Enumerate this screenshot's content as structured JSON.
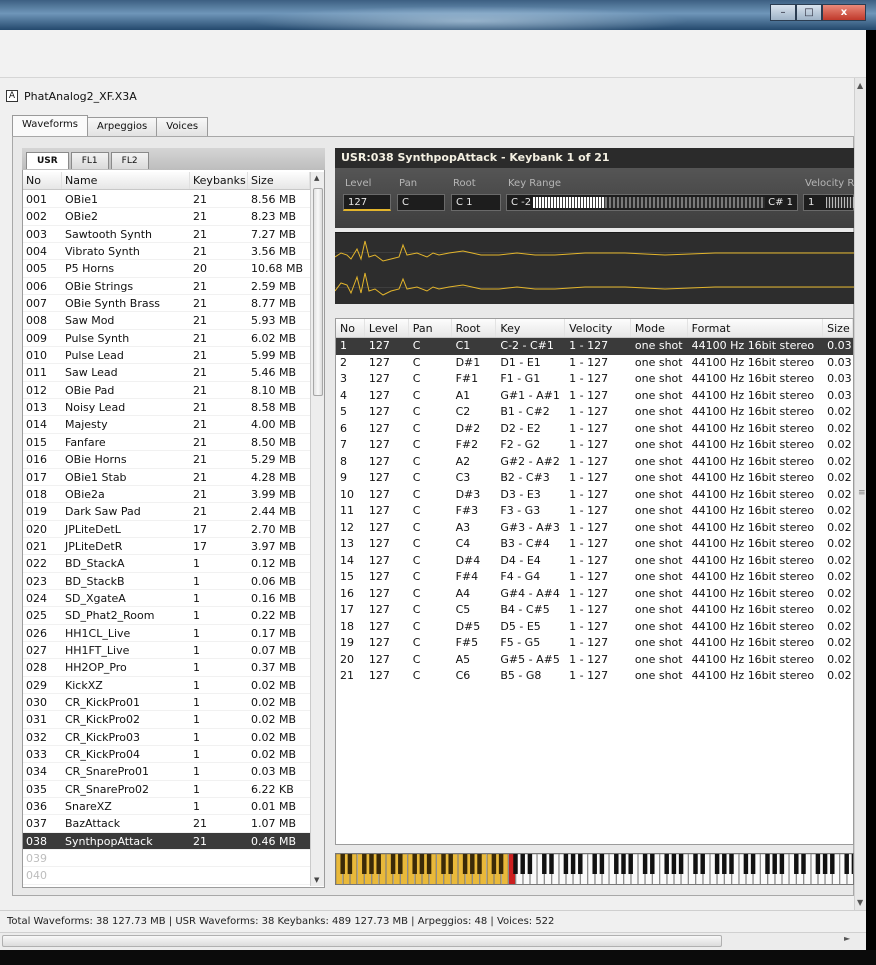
{
  "window": {
    "minimize_glyph": "–",
    "maximize_glyph": "□",
    "close_glyph": "x",
    "bg_color": "#f0f0f0",
    "title_gradient": [
      "#3c5f82",
      "#6f96b9",
      "#24496d"
    ]
  },
  "document": {
    "icon_letter": "A",
    "title": "PhatAnalog2_XF.X3A"
  },
  "tabs": [
    {
      "label": "Waveforms",
      "active": true
    },
    {
      "label": "Arpeggios",
      "active": false
    },
    {
      "label": "Voices",
      "active": false
    }
  ],
  "subtabs": [
    {
      "label": "USR",
      "active": true
    },
    {
      "label": "FL1",
      "active": false
    },
    {
      "label": "FL2",
      "active": false
    }
  ],
  "waveform_list": {
    "columns": [
      "No",
      "Name",
      "Keybanks",
      "Size"
    ],
    "rows": [
      [
        "001",
        "OBie1",
        "21",
        "8.56 MB"
      ],
      [
        "002",
        "OBie2",
        "21",
        "8.23 MB"
      ],
      [
        "003",
        "Sawtooth Synth",
        "21",
        "7.27 MB"
      ],
      [
        "004",
        "Vibrato Synth",
        "21",
        "3.56 MB"
      ],
      [
        "005",
        "P5 Horns",
        "20",
        "10.68 MB"
      ],
      [
        "006",
        "OBie Strings",
        "21",
        "2.59 MB"
      ],
      [
        "007",
        "OBie Synth Brass",
        "21",
        "8.77 MB"
      ],
      [
        "008",
        "Saw Mod",
        "21",
        "5.93 MB"
      ],
      [
        "009",
        "Pulse Synth",
        "21",
        "6.02 MB"
      ],
      [
        "010",
        "Pulse Lead",
        "21",
        "5.99 MB"
      ],
      [
        "011",
        "Saw Lead",
        "21",
        "5.46 MB"
      ],
      [
        "012",
        "OBie Pad",
        "21",
        "8.10 MB"
      ],
      [
        "013",
        "Noisy Lead",
        "21",
        "8.58 MB"
      ],
      [
        "014",
        "Majesty",
        "21",
        "4.00 MB"
      ],
      [
        "015",
        "Fanfare",
        "21",
        "8.50 MB"
      ],
      [
        "016",
        "OBie Horns",
        "21",
        "5.29 MB"
      ],
      [
        "017",
        "OBie1 Stab",
        "21",
        "4.28 MB"
      ],
      [
        "018",
        "OBie2a",
        "21",
        "3.99 MB"
      ],
      [
        "019",
        "Dark Saw Pad",
        "21",
        "2.44 MB"
      ],
      [
        "020",
        "JPLiteDetL",
        "17",
        "2.70 MB"
      ],
      [
        "021",
        "JPLiteDetR",
        "17",
        "3.97 MB"
      ],
      [
        "022",
        "BD_StackA",
        "1",
        "0.12 MB"
      ],
      [
        "023",
        "BD_StackB",
        "1",
        "0.06 MB"
      ],
      [
        "024",
        "SD_XgateA",
        "1",
        "0.16 MB"
      ],
      [
        "025",
        "SD_Phat2_Room",
        "1",
        "0.22 MB"
      ],
      [
        "026",
        "HH1CL_Live",
        "1",
        "0.17 MB"
      ],
      [
        "027",
        "HH1FT_Live",
        "1",
        "0.07 MB"
      ],
      [
        "028",
        "HH2OP_Pro",
        "1",
        "0.37 MB"
      ],
      [
        "029",
        "KickXZ",
        "1",
        "0.02 MB"
      ],
      [
        "030",
        "CR_KickPro01",
        "1",
        "0.02 MB"
      ],
      [
        "031",
        "CR_KickPro02",
        "1",
        "0.02 MB"
      ],
      [
        "032",
        "CR_KickPro03",
        "1",
        "0.02 MB"
      ],
      [
        "033",
        "CR_KickPro04",
        "1",
        "0.02 MB"
      ],
      [
        "034",
        "CR_SnarePro01",
        "1",
        "0.03 MB"
      ],
      [
        "035",
        "CR_SnarePro02",
        "1",
        "6.22 KB"
      ],
      [
        "036",
        "SnareXZ",
        "1",
        "0.01 MB"
      ],
      [
        "037",
        "BazAttack",
        "21",
        "1.07 MB"
      ],
      [
        "038",
        "SynthpopAttack",
        "21",
        "0.46 MB"
      ],
      [
        "039",
        "",
        "",
        ""
      ],
      [
        "040",
        "",
        "",
        ""
      ]
    ],
    "selected_index": 37
  },
  "detail": {
    "header": "USR:038 SynthpopAttack - Keybank 1 of 21",
    "labels": {
      "level": "Level",
      "pan": "Pan",
      "root": "Root",
      "key_range": "Key Range",
      "velocity": "Velocity R"
    },
    "values": {
      "level": "127",
      "pan": "C",
      "root": "C 1",
      "key_low": "C -2",
      "key_high": "C# 1",
      "velocity_low": "1"
    },
    "accent_color": "#e3b52c"
  },
  "keybank_table": {
    "columns": [
      "No",
      "Level",
      "Pan",
      "Root",
      "Key",
      "Velocity",
      "Mode",
      "Format",
      "Size"
    ],
    "rows": [
      [
        "1",
        "127",
        "C",
        "C1",
        "C-2 - C#1",
        "1 - 127",
        "one shot",
        "44100 Hz 16bit stereo",
        "0.03"
      ],
      [
        "2",
        "127",
        "C",
        "D#1",
        "D1 - E1",
        "1 - 127",
        "one shot",
        "44100 Hz 16bit stereo",
        "0.03"
      ],
      [
        "3",
        "127",
        "C",
        "F#1",
        "F1 - G1",
        "1 - 127",
        "one shot",
        "44100 Hz 16bit stereo",
        "0.03"
      ],
      [
        "4",
        "127",
        "C",
        "A1",
        "G#1 - A#1",
        "1 - 127",
        "one shot",
        "44100 Hz 16bit stereo",
        "0.03"
      ],
      [
        "5",
        "127",
        "C",
        "C2",
        "B1 - C#2",
        "1 - 127",
        "one shot",
        "44100 Hz 16bit stereo",
        "0.02"
      ],
      [
        "6",
        "127",
        "C",
        "D#2",
        "D2 - E2",
        "1 - 127",
        "one shot",
        "44100 Hz 16bit stereo",
        "0.02"
      ],
      [
        "7",
        "127",
        "C",
        "F#2",
        "F2 - G2",
        "1 - 127",
        "one shot",
        "44100 Hz 16bit stereo",
        "0.02"
      ],
      [
        "8",
        "127",
        "C",
        "A2",
        "G#2 - A#2",
        "1 - 127",
        "one shot",
        "44100 Hz 16bit stereo",
        "0.02"
      ],
      [
        "9",
        "127",
        "C",
        "C3",
        "B2 - C#3",
        "1 - 127",
        "one shot",
        "44100 Hz 16bit stereo",
        "0.02"
      ],
      [
        "10",
        "127",
        "C",
        "D#3",
        "D3 - E3",
        "1 - 127",
        "one shot",
        "44100 Hz 16bit stereo",
        "0.02"
      ],
      [
        "11",
        "127",
        "C",
        "F#3",
        "F3 - G3",
        "1 - 127",
        "one shot",
        "44100 Hz 16bit stereo",
        "0.02"
      ],
      [
        "12",
        "127",
        "C",
        "A3",
        "G#3 - A#3",
        "1 - 127",
        "one shot",
        "44100 Hz 16bit stereo",
        "0.02"
      ],
      [
        "13",
        "127",
        "C",
        "C4",
        "B3 - C#4",
        "1 - 127",
        "one shot",
        "44100 Hz 16bit stereo",
        "0.02"
      ],
      [
        "14",
        "127",
        "C",
        "D#4",
        "D4 - E4",
        "1 - 127",
        "one shot",
        "44100 Hz 16bit stereo",
        "0.02"
      ],
      [
        "15",
        "127",
        "C",
        "F#4",
        "F4 - G4",
        "1 - 127",
        "one shot",
        "44100 Hz 16bit stereo",
        "0.02"
      ],
      [
        "16",
        "127",
        "C",
        "A4",
        "G#4 - A#4",
        "1 - 127",
        "one shot",
        "44100 Hz 16bit stereo",
        "0.02"
      ],
      [
        "17",
        "127",
        "C",
        "C5",
        "B4 - C#5",
        "1 - 127",
        "one shot",
        "44100 Hz 16bit stereo",
        "0.02"
      ],
      [
        "18",
        "127",
        "C",
        "D#5",
        "D5 - E5",
        "1 - 127",
        "one shot",
        "44100 Hz 16bit stereo",
        "0.02"
      ],
      [
        "19",
        "127",
        "C",
        "F#5",
        "F5 - G5",
        "1 - 127",
        "one shot",
        "44100 Hz 16bit stereo",
        "0.02"
      ],
      [
        "20",
        "127",
        "C",
        "A5",
        "G#5 - A#5",
        "1 - 127",
        "one shot",
        "44100 Hz 16bit stereo",
        "0.02"
      ],
      [
        "21",
        "127",
        "C",
        "C6",
        "B5 - G8",
        "1 - 127",
        "one shot",
        "44100 Hz 16bit stereo",
        "0.02"
      ]
    ],
    "selected_index": 0
  },
  "status": {
    "text": "Total Waveforms: 38   127.73 MB   |   USR  Waveforms: 38  Keybanks: 489  127.73 MB   |   Arpeggios: 48   |   Voices: 522"
  }
}
